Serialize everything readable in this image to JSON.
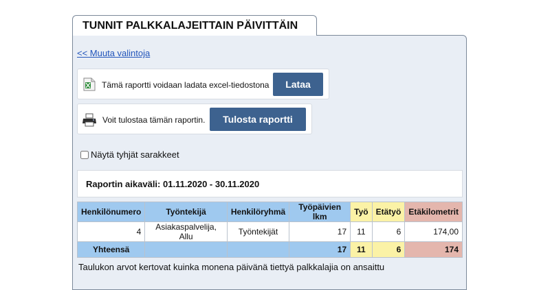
{
  "page": {
    "title": "TUNNIT PALKKALAJEITTAIN PÄIVITTÄIN"
  },
  "nav": {
    "back_link": "<< Muuta valintoja"
  },
  "excel": {
    "text": "Tämä raportti voidaan ladata excel-tiedostona",
    "button": "Lataa"
  },
  "print": {
    "text": "Voit tulostaa tämän raportin.",
    "button": "Tulosta raportti"
  },
  "options": {
    "show_empty_label": "Näytä tyhjät sarakkeet",
    "show_empty_checked": false
  },
  "report": {
    "period": "Raportin aikaväli: 01.11.2020 - 30.11.2020"
  },
  "table": {
    "headers": [
      "Henkilönumero",
      "Työntekijä",
      "Henkilöryhmä",
      "Työpäivien lkm",
      "Työ",
      "Etätyö",
      "Etäkilometrit"
    ],
    "rows": [
      [
        "4",
        "Asiakaspalvelija, Allu",
        "Työntekijät",
        "17",
        "11",
        "6",
        "174,00"
      ]
    ],
    "total": [
      "Yhteensä",
      "",
      "",
      "17",
      "11",
      "6",
      "174"
    ]
  },
  "footer": {
    "note": "Taulukon arvot kertovat kuinka monena päivänä tiettyä palkkalajia on ansaittu"
  },
  "colors": {
    "header_blue": "#9fc9ef",
    "header_yellow": "#fbf2a6",
    "header_red": "#e4b6ad",
    "button": "#3d628f",
    "link": "#2255bb",
    "panel": "#e9eef5"
  },
  "icons": {
    "excel": "excel-file-icon",
    "print": "printer-icon"
  }
}
